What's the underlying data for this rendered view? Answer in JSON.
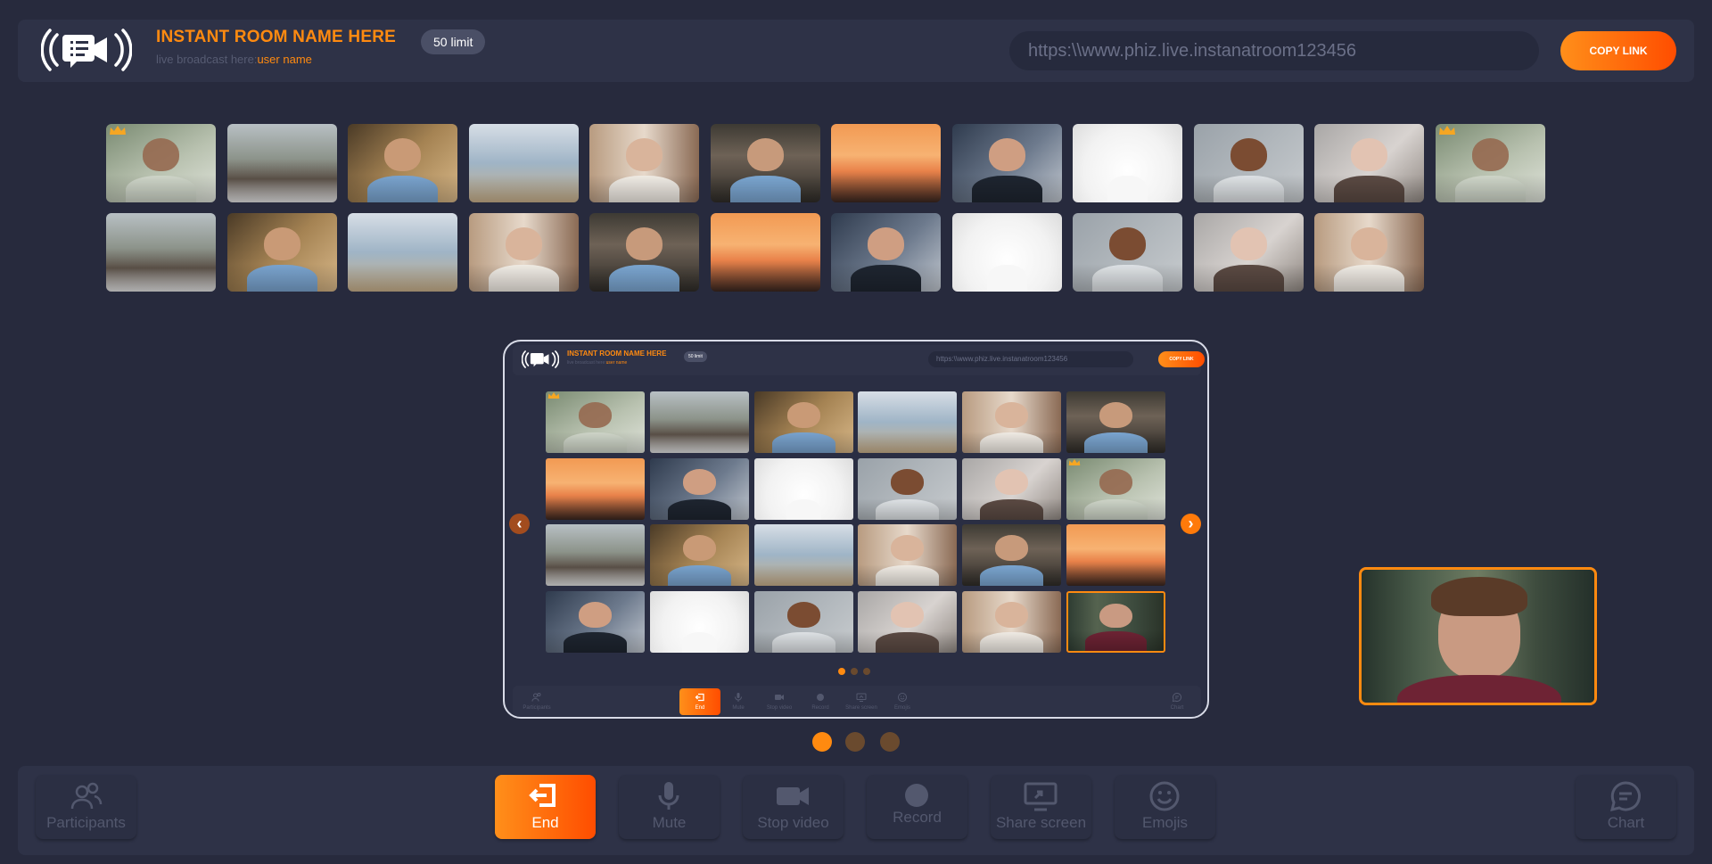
{
  "header": {
    "room_title": "INSTANT ROOM NAME HERE",
    "subtitle_prefix": "live broadcast here:",
    "user_name": "user name",
    "limit_badge": "50 limit",
    "room_url": "https:\\\\www.phiz.live.instanatroom123456",
    "copy_label": "COPY LINK"
  },
  "mini": {
    "room_title": "INSTANT ROOM NAME HERE",
    "subtitle_prefix": "live broadcast here:",
    "user_name": "user name",
    "limit_badge": "50 limit",
    "room_url": "https:\\\\www.phiz.live.instanatroom123456",
    "copy_label": "COPY LINK",
    "prev_arrow": "‹",
    "next_arrow": "›",
    "toolbar": [
      {
        "label": "Participants",
        "icon": "participants-icon"
      },
      {
        "label": "End",
        "icon": "end-icon"
      },
      {
        "label": "Mute",
        "icon": "microphone-icon"
      },
      {
        "label": "Stop video",
        "icon": "video-camera-icon"
      },
      {
        "label": "Record",
        "icon": "record-icon"
      },
      {
        "label": "Share screen",
        "icon": "share-screen-icon"
      },
      {
        "label": "Emojis",
        "icon": "emoji-icon"
      },
      {
        "label": "Chart",
        "icon": "chat-icon"
      }
    ],
    "active_page": 1,
    "page_count": 3
  },
  "toolbar": {
    "participants": "Participants",
    "end": "End",
    "mute": "Mute",
    "stop_video": "Stop video",
    "record": "Record",
    "share_screen": "Share screen",
    "emojis": "Emojis",
    "chart": "Chart"
  },
  "pager": {
    "active_page": 1,
    "page_count": 3
  },
  "colors": {
    "accent": "#ff8a10",
    "background": "#272a3d",
    "panel": "#2e3247",
    "muted_text": "#53586e"
  }
}
